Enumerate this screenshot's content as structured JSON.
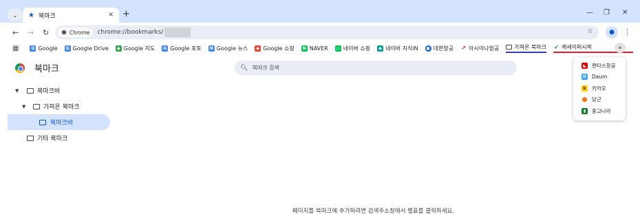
{
  "tabs": {
    "active": {
      "title": "북마크",
      "icon": "bookmark-star-icon"
    },
    "new_tab_label": "+"
  },
  "toolbar": {
    "chip_label": "Chrome",
    "url": "chrome://bookmarks/"
  },
  "bookmarks_bar": [
    {
      "label": "Google",
      "icon": "google-icon",
      "color": "#4285f4"
    },
    {
      "label": "Google Drive",
      "icon": "google-icon",
      "color": "#4285f4"
    },
    {
      "label": "Google 지도",
      "icon": "maps-icon",
      "color": "#34a853"
    },
    {
      "label": "Google 포토",
      "icon": "google-icon",
      "color": "#4285f4"
    },
    {
      "label": "Google 뉴스",
      "icon": "news-icon",
      "color": "#4285f4"
    },
    {
      "label": "Google 쇼핑",
      "icon": "shopping-icon",
      "color": "#ea4335"
    },
    {
      "label": "NAVER",
      "icon": "naver-icon",
      "color": "#03c75a"
    },
    {
      "label": "네이버 쇼핑",
      "icon": "naver-shopping-icon",
      "color": "#03c75a"
    },
    {
      "label": "네이버 지식iN",
      "icon": "naver-kin-icon",
      "color": "#00a495"
    },
    {
      "label": "대한항공",
      "icon": "korean-air-icon",
      "color": "#0064de"
    },
    {
      "label": "아시아나항공",
      "icon": "asiana-icon",
      "color": "#e60012"
    },
    {
      "label": "가져온 북마크",
      "icon": "folder-icon",
      "color": "#444444"
    },
    {
      "label": "캐세이퍼시픽",
      "icon": "cathay-icon",
      "color": "#006564"
    }
  ],
  "overflow_menu": [
    {
      "label": "콴타스항공",
      "icon": "qantas-icon",
      "color": "#e40000"
    },
    {
      "label": "Daum",
      "icon": "daum-icon",
      "color": "#3aa0ff"
    },
    {
      "label": "카카오",
      "icon": "kakao-icon",
      "color": "#ffcd00"
    },
    {
      "label": "당근",
      "icon": "carrot-icon",
      "color": "#ff6f0f"
    },
    {
      "label": "중고나라",
      "icon": "joonggonara-icon",
      "color": "#127c2a"
    }
  ],
  "page": {
    "title": "북마크",
    "search_placeholder": "북마크 검색",
    "footer": "페이지를 북마크에 추가하려면 검색주소창에서 별표를 클릭하세요."
  },
  "tree": [
    {
      "label": "북마크바",
      "expanded": true,
      "level": 0
    },
    {
      "label": "가져온 북마크",
      "expanded": true,
      "level": 1
    },
    {
      "label": "북마크바",
      "selected": true,
      "level": 2
    },
    {
      "label": "기타 북마크",
      "level": 0
    }
  ],
  "colors": {
    "accent": "#0b57d0",
    "tabstrip": "#d3e3fd",
    "omnibox": "#e9eef6",
    "blue_underline": "#2a3bd6",
    "red_underline": "#e11d1d"
  }
}
